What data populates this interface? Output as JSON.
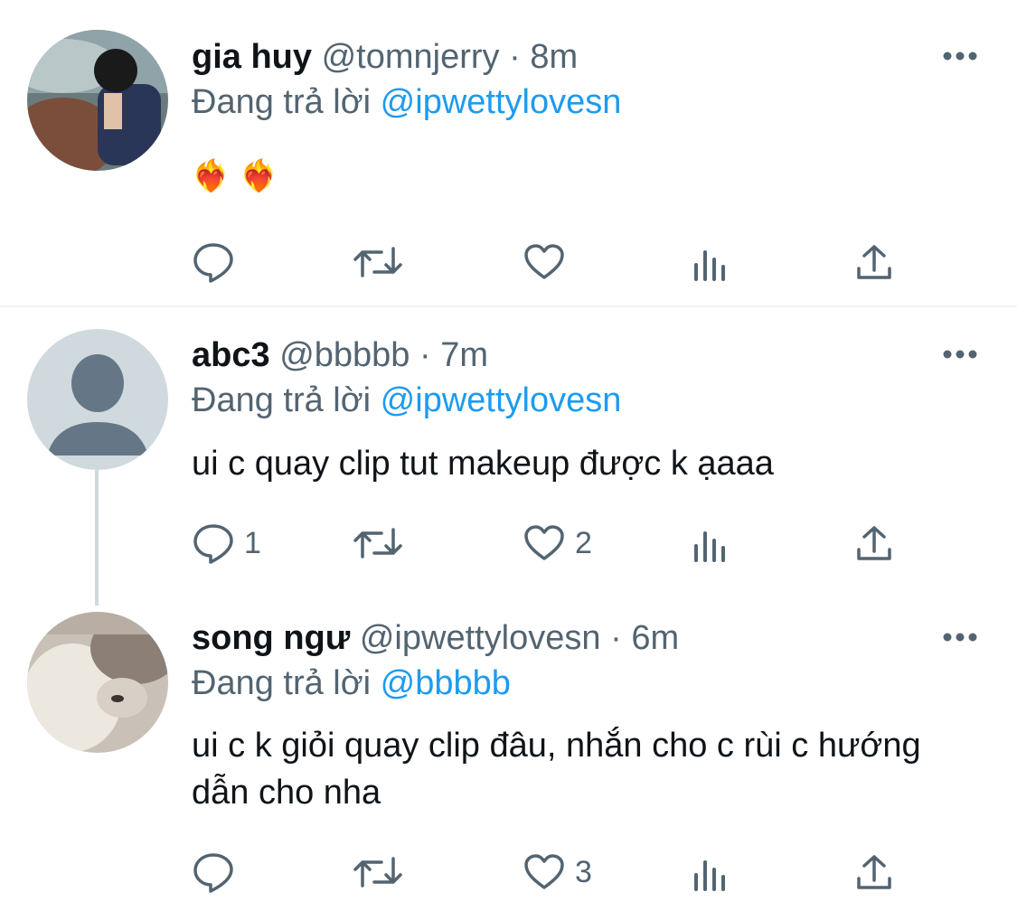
{
  "tweets": [
    {
      "name": "gia huy",
      "handle": "@tomnjerry",
      "dot": "·",
      "time": "8m",
      "replying_prefix": "Đang trả lời",
      "replying_to": "@ipwettylovesn",
      "text": "",
      "emojis": [
        "❤️‍🔥",
        "❤️‍🔥"
      ],
      "reply_count": "",
      "retweet_count": "",
      "like_count": ""
    },
    {
      "name": "abc3",
      "handle": "@bbbbb",
      "dot": "·",
      "time": "7m",
      "replying_prefix": "Đang trả lời",
      "replying_to": "@ipwettylovesn",
      "text": "ui c quay clip tut makeup được k ạaaa",
      "reply_count": "1",
      "retweet_count": "",
      "like_count": "2"
    },
    {
      "name": "song ngư",
      "handle": "@ipwettylovesn",
      "dot": "·",
      "time": "6m",
      "replying_prefix": "Đang trả lời",
      "replying_to": "@bbbbb",
      "text": "ui c k giỏi quay clip đâu, nhắn cho c rùi c hướng dẫn cho nha",
      "reply_count": "",
      "retweet_count": "",
      "like_count": "3"
    }
  ],
  "icons": {
    "reply": "reply-icon",
    "retweet": "retweet-icon",
    "like": "heart-icon",
    "views": "views-icon",
    "share": "share-icon",
    "more": "more-icon"
  },
  "colors": {
    "text": "#0f1419",
    "secondary": "#536471",
    "link": "#1d9bf0",
    "divider": "#eff3f4",
    "thread_line": "#cfd9de"
  }
}
